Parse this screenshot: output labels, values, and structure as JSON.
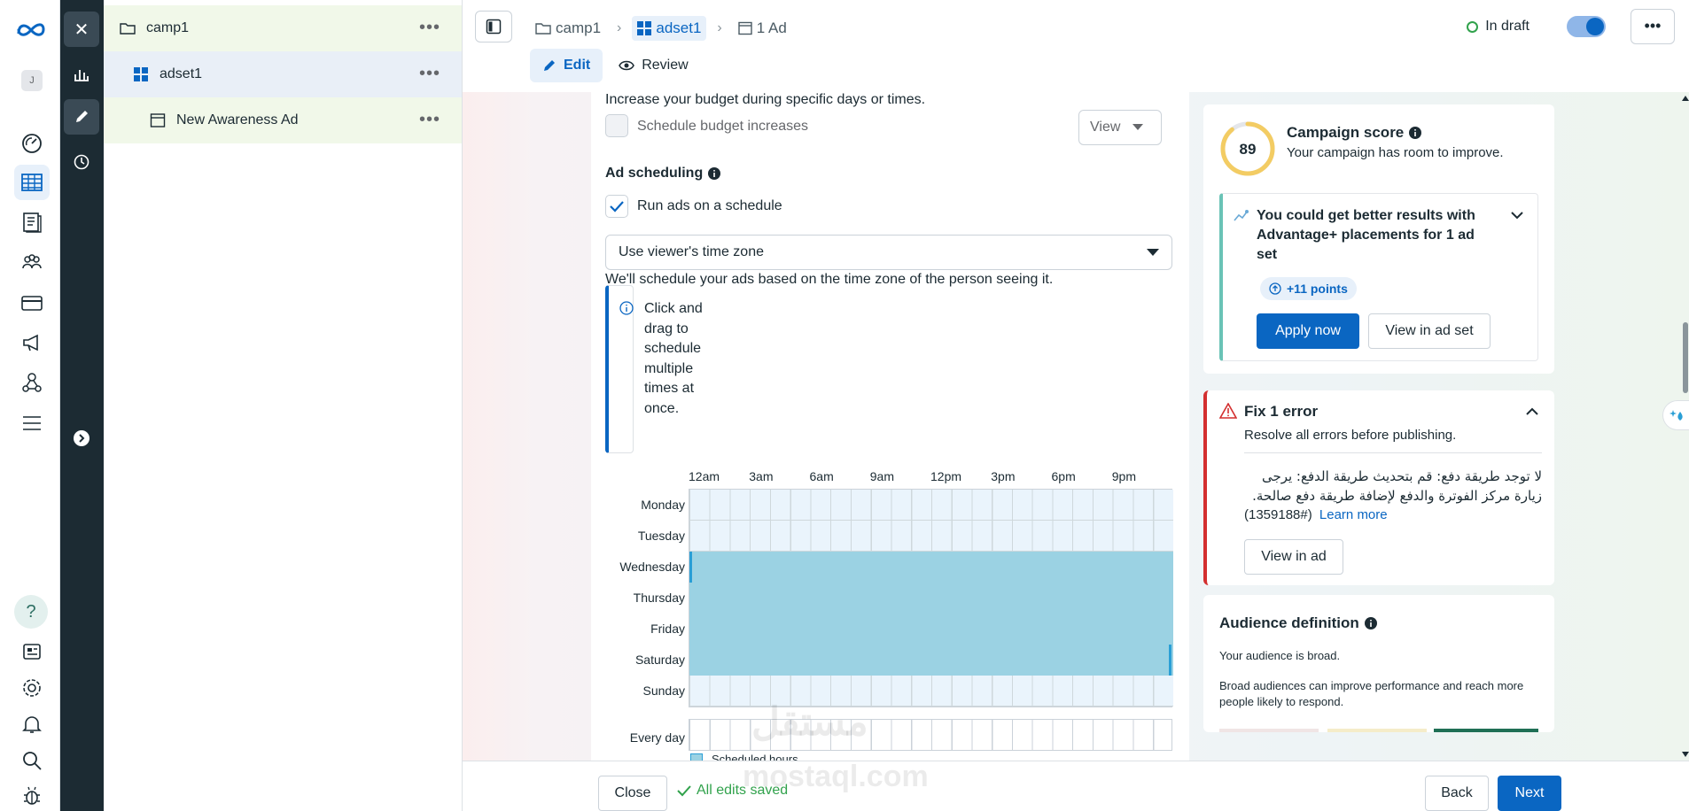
{
  "rail": {
    "avatar_letter": "J",
    "help_glyph": "?",
    "icons": [
      "meta-logo-icon",
      "dashboard-gauge-icon",
      "table-grid-icon",
      "pages-icon",
      "audience-icon",
      "billing-card-icon",
      "megaphone-icon",
      "network-icon",
      "menu-icon",
      "help-icon",
      "news-icon",
      "settings-gear-icon",
      "bell-icon",
      "search-icon",
      "bug-icon"
    ]
  },
  "strip": {
    "close_glyph": "✕",
    "icons": [
      "close-icon",
      "bar-chart-icon",
      "pencil-icon",
      "clock-icon",
      "chevron-right-circle-icon"
    ]
  },
  "tree": {
    "items": [
      {
        "label": "camp1",
        "icon": "folder-icon"
      },
      {
        "label": "adset1",
        "icon": "adset-grid-icon"
      },
      {
        "label": "New Awareness Ad",
        "icon": "ad-window-icon"
      }
    ],
    "more_glyph": "•••"
  },
  "topbar": {
    "breadcrumb": [
      "camp1",
      "adset1",
      "1 Ad"
    ],
    "sep": "›",
    "status": "In draft",
    "more_glyph": "•••",
    "tabs": [
      {
        "label": "Edit"
      },
      {
        "label": "Review"
      }
    ]
  },
  "form": {
    "budget_desc": "Increase your budget during specific days or times.",
    "schedule_budget_label": "Schedule budget increases",
    "view_label": "View",
    "ad_scheduling_title": "Ad scheduling",
    "run_schedule_label": "Run ads on a schedule",
    "timezone_value": "Use viewer's time zone",
    "timezone_desc": "We'll schedule your ads based on the time zone of the person seeing it.",
    "info_text": "Click and drag to schedule multiple times at once.",
    "hours": [
      "12am",
      "3am",
      "6am",
      "9am",
      "12pm",
      "3pm",
      "6pm",
      "9pm"
    ],
    "days": [
      "Monday",
      "Tuesday",
      "Wednesday",
      "Thursday",
      "Friday",
      "Saturday",
      "Sunday",
      "Every day"
    ],
    "scheduled_days": [
      "Wednesday",
      "Thursday",
      "Friday",
      "Saturday"
    ],
    "legend": "Scheduled hours",
    "colors": {
      "scheduled": "#9bd2e3",
      "empty": "#eaf4fc",
      "accent": "#2a9fd6"
    }
  },
  "score_card": {
    "score": "89",
    "score_value": 89,
    "title": "Campaign score",
    "subtitle": "Your campaign has room to improve.",
    "suggestion": "You could get better results with Advantage+ placements for 1 ad set",
    "points": "+11 points",
    "apply_label": "Apply now",
    "view_adset_label": "View in ad set"
  },
  "error_card": {
    "title": "Fix 1 error",
    "subtitle": "Resolve all errors before publishing.",
    "message_ar": "لا توجد طريقة دفع: قم بتحديث طريقة الدفع: يرجى زيارة مركز الفوترة والدفع لإضافة طريقة دفع صالحة.",
    "code": "(1359188#)",
    "learn_more": "Learn more",
    "view_ad_label": "View in ad"
  },
  "audience_card": {
    "title": "Audience definition",
    "line1": "Your audience is broad.",
    "line2": "Broad audiences can improve performance and reach more people likely to respond."
  },
  "bottombar": {
    "close_label": "Close",
    "saved_label": "All edits saved",
    "back_label": "Back",
    "next_label": "Next"
  },
  "watermark": {
    "ar": "مستقل",
    "en": "mostaql.com"
  }
}
